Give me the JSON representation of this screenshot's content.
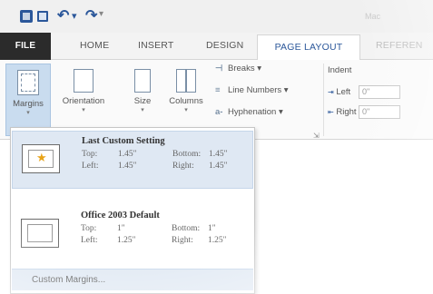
{
  "window": {
    "title": "Mac"
  },
  "qat": {
    "undo_glyph": "↶",
    "redo_glyph": "↷",
    "more_glyph": "▾"
  },
  "tabs": {
    "file": "FILE",
    "home": "HOME",
    "insert": "INSERT",
    "design": "DESIGN",
    "page_layout": "PAGE LAYOUT",
    "references": "REFEREN"
  },
  "ribbon": {
    "margins": "Margins",
    "orientation": "Orientation",
    "size": "Size",
    "columns": "Columns",
    "breaks": "Breaks",
    "line_numbers": "Line Numbers",
    "hyphenation": "Hyphenation",
    "indent": "Indent",
    "left_label": "Left",
    "left_value": "0\"",
    "right_label": "Right",
    "right_value": "0\""
  },
  "margins_menu": {
    "options": [
      {
        "title": "Last Custom Setting",
        "top_label": "Top:",
        "top_value": "1.45\"",
        "bottom_label": "Bottom:",
        "bottom_value": "1.45\"",
        "left_label": "Left:",
        "left_value": "1.45\"",
        "right_label": "Right:",
        "right_value": "1.45\""
      },
      {
        "title": "Office 2003 Default",
        "top_label": "Top:",
        "top_value": "1\"",
        "bottom_label": "Bottom:",
        "bottom_value": "1\"",
        "left_label": "Left:",
        "left_value": "1.25\"",
        "right_label": "Right:",
        "right_value": "1.25\""
      }
    ],
    "custom_margins": "Custom Margins..."
  },
  "colors": {
    "accent": "#2b579a",
    "selected_bg": "#dfe8f3",
    "file_tab": "#2b2b2b"
  }
}
